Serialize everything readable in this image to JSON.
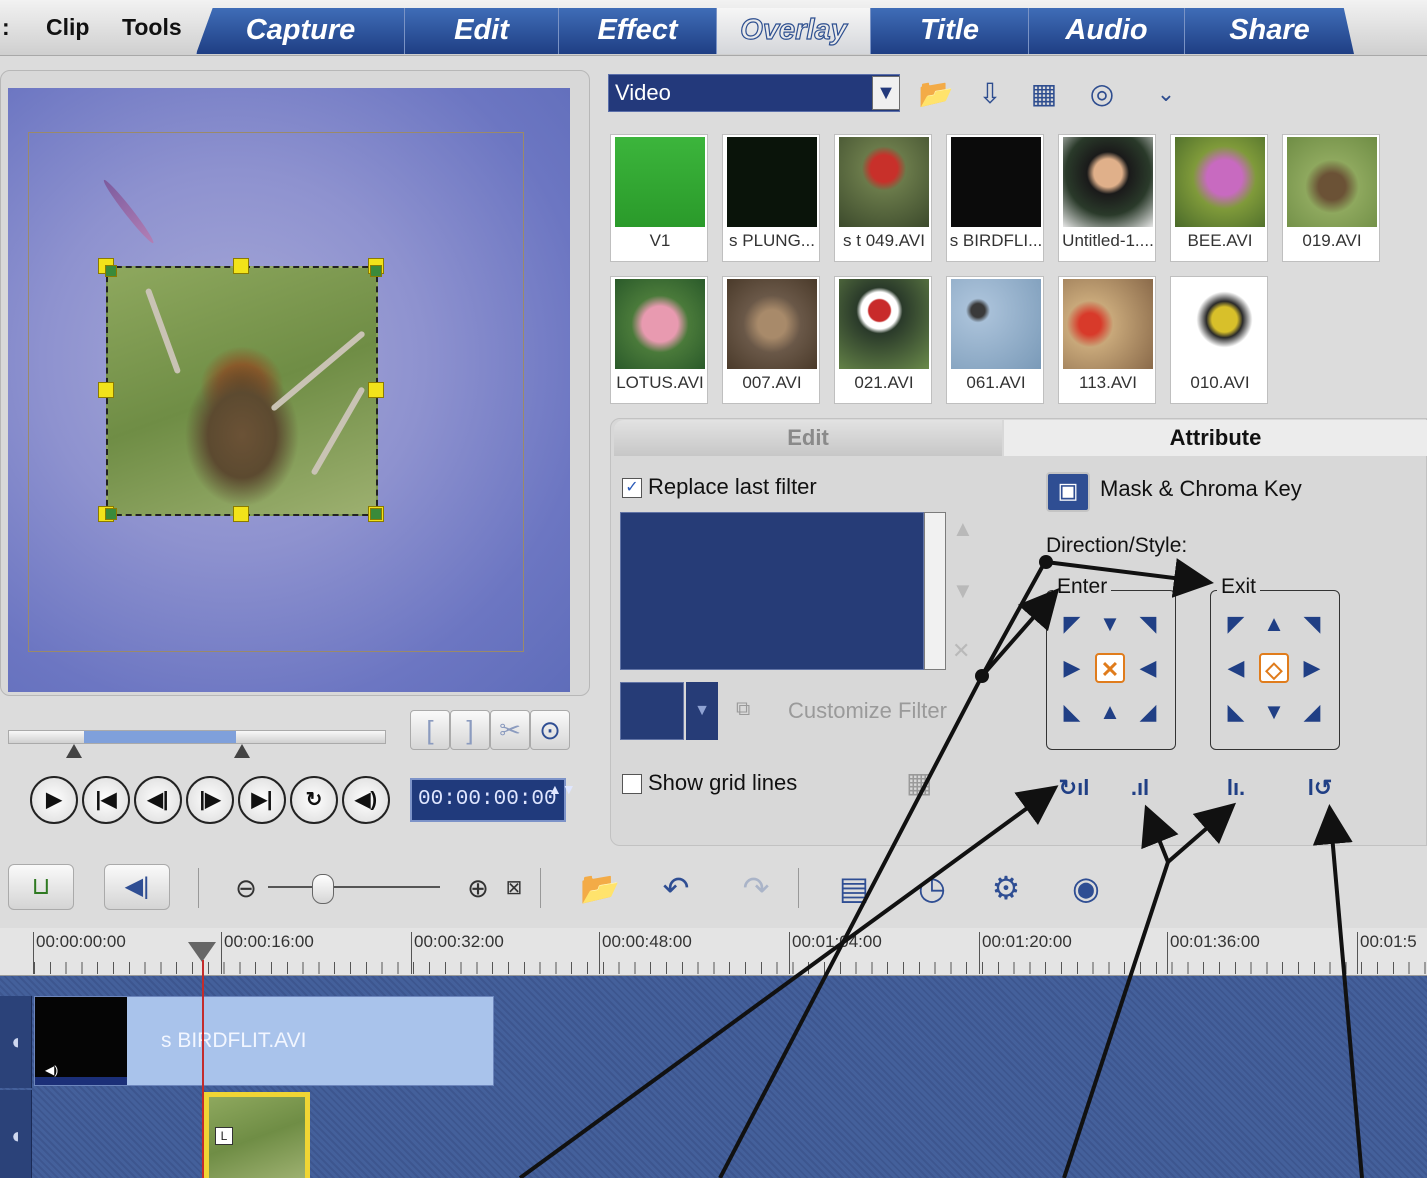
{
  "menu": {
    "clip": "Clip",
    "tools": "Tools",
    "leading_colon": ":"
  },
  "tabs": [
    {
      "label": "Capture"
    },
    {
      "label": "Edit"
    },
    {
      "label": "Effect"
    },
    {
      "label": "Overlay",
      "active": true
    },
    {
      "label": "Title"
    },
    {
      "label": "Audio"
    },
    {
      "label": "Share"
    }
  ],
  "preview": {
    "trim_buttons": [
      "[",
      "]",
      "✂",
      "⊙"
    ],
    "timecode": "00:00:00:00",
    "timecode_spin": "▲▼"
  },
  "library": {
    "dropdown_value": "Video",
    "dropdown_arrow": "▼",
    "icons": [
      "folder-open-icon",
      "import-icon",
      "sort-icon",
      "options-icon",
      "expand-icon"
    ],
    "thumbnails": [
      {
        "label": "V1"
      },
      {
        "label": "s PLUNG..."
      },
      {
        "label": "s t  049.AVI"
      },
      {
        "label": "s BIRDFLI..."
      },
      {
        "label": "Untitled-1...."
      },
      {
        "label": "BEE.AVI"
      },
      {
        "label": "019.AVI"
      },
      {
        "label": "LOTUS.AVI"
      },
      {
        "label": "007.AVI"
      },
      {
        "label": "021.AVI"
      },
      {
        "label": "061.AVI"
      },
      {
        "label": "113.AVI"
      },
      {
        "label": "010.AVI"
      }
    ]
  },
  "options": {
    "tab_edit": "Edit",
    "tab_attribute": "Attribute",
    "replace_last_filter": "Replace last filter",
    "replace_checked": "✓",
    "customize_filter": "Customize Filter",
    "show_grid_lines": "Show grid lines",
    "mask_chroma_key": "Mask & Chroma Key",
    "direction_style": "Direction/Style:",
    "enter": "Enter",
    "exit": "Exit"
  },
  "ruler": {
    "labels": [
      "00:00:00:00",
      "00:00:16:00",
      "00:00:32:00",
      "00:00:48:00",
      "00:01:04:00",
      "00:01:20:00",
      "00:01:36:00",
      "00:01:5"
    ]
  },
  "timeline": {
    "video_clip_name": "s BIRDFLIT.AVI"
  },
  "colors": {
    "tab_blue": "#2a4f98",
    "track_bg": "#3d568f",
    "accent_orange": "#e07c1c",
    "selection_yellow": "#f2e31a"
  }
}
